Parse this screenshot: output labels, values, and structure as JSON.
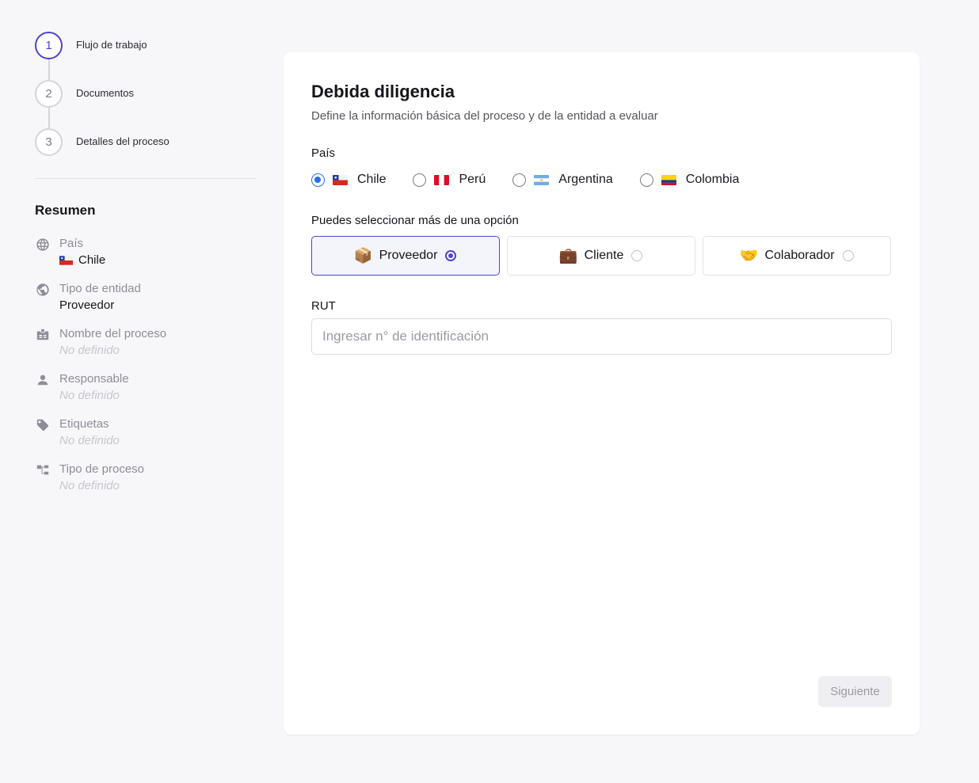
{
  "steps": [
    {
      "number": "1",
      "label": "Flujo de trabajo",
      "active": true
    },
    {
      "number": "2",
      "label": "Documentos",
      "active": false
    },
    {
      "number": "3",
      "label": "Detalles del proceso",
      "active": false
    }
  ],
  "summary": {
    "title": "Resumen",
    "items": [
      {
        "icon": "globe-icon",
        "label": "País",
        "value": "Chile",
        "flag": "cl",
        "empty": false
      },
      {
        "icon": "earth-icon",
        "label": "Tipo de entidad",
        "value": "Proveedor",
        "empty": false
      },
      {
        "icon": "badge-icon",
        "label": "Nombre del proceso",
        "value": "No definido",
        "empty": true
      },
      {
        "icon": "person-icon",
        "label": "Responsable",
        "value": "No definido",
        "empty": true
      },
      {
        "icon": "tag-icon",
        "label": "Etiquetas",
        "value": "No definido",
        "empty": true
      },
      {
        "icon": "hierarchy-icon",
        "label": "Tipo de proceso",
        "value": "No definido",
        "empty": true
      }
    ]
  },
  "form": {
    "title": "Debida diligencia",
    "subtitle": "Define la información básica del proceso y de la entidad a evaluar",
    "country_label": "País",
    "countries": [
      {
        "name": "Chile",
        "code": "cl",
        "checked": true
      },
      {
        "name": "Perú",
        "code": "pe",
        "checked": false
      },
      {
        "name": "Argentina",
        "code": "ar",
        "checked": false
      },
      {
        "name": "Colombia",
        "code": "co",
        "checked": false
      }
    ],
    "entity_label": "Puedes seleccionar más de una opción",
    "entities": [
      {
        "name": "Proveedor",
        "emoji": "📦",
        "selected": true
      },
      {
        "name": "Cliente",
        "emoji": "💼",
        "selected": false
      },
      {
        "name": "Colaborador",
        "emoji": "🤝",
        "selected": false
      }
    ],
    "rut_label": "RUT",
    "rut_placeholder": "Ingresar n° de identificación",
    "rut_value": "",
    "next_label": "Siguiente"
  },
  "colors": {
    "accent": "#4b46c9",
    "radio_blue": "#2a6fe0",
    "background": "#f7f7fa"
  }
}
